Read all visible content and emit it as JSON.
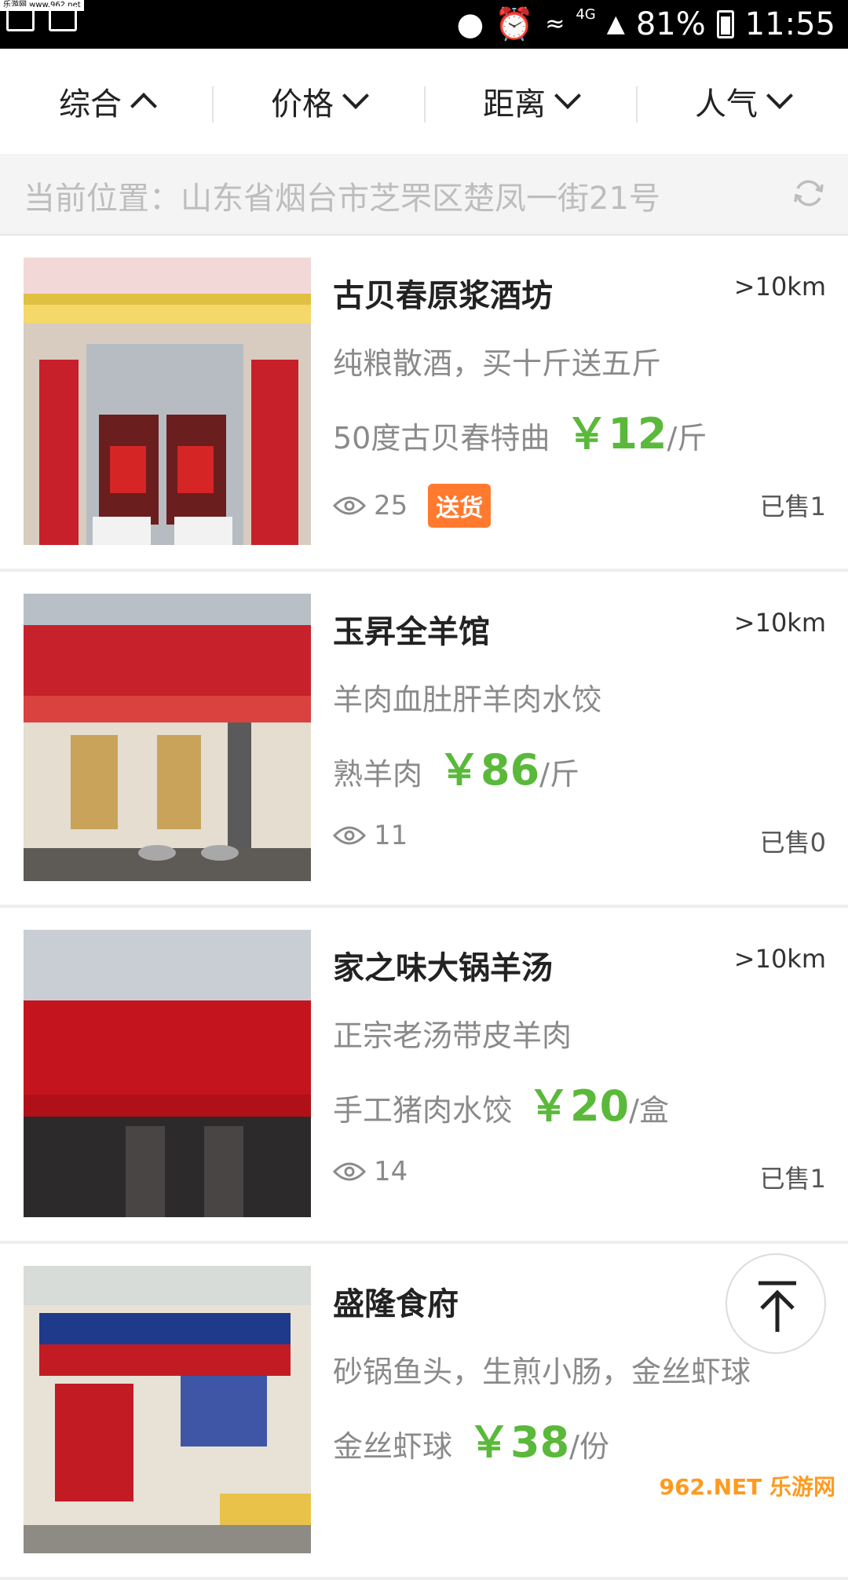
{
  "status_bar": {
    "watermark": "乐游网 www.962.net",
    "network": "4G",
    "battery": "81%",
    "time": "11:55"
  },
  "filters": [
    {
      "label": "综合",
      "icon": "chevron-up-icon"
    },
    {
      "label": "价格",
      "icon": "chevron-down-icon"
    },
    {
      "label": "距离",
      "icon": "chevron-down-icon"
    },
    {
      "label": "人气",
      "icon": "chevron-down-icon"
    }
  ],
  "location": {
    "text": "当前位置：山东省烟台市芝罘区楚凤一街21号",
    "icon": "refresh-icon"
  },
  "items": [
    {
      "title": "古贝春原浆酒坊",
      "distance": ">10km",
      "desc": "纯粮散酒，买十斤送五斤",
      "product": "50度古贝春特曲",
      "price": "￥12",
      "unit": "/斤",
      "views": "25",
      "tag": "送货",
      "sold": "已售1"
    },
    {
      "title": "玉昇全羊馆",
      "distance": ">10km",
      "desc": "羊肉血肚肝羊肉水饺",
      "product": "熟羊肉",
      "price": "￥86",
      "unit": "/斤",
      "views": "11",
      "sold": "已售0"
    },
    {
      "title": "家之味大锅羊汤",
      "distance": ">10km",
      "desc": "正宗老汤带皮羊肉",
      "product": "手工猪肉水饺",
      "price": "￥20",
      "unit": "/盒",
      "views": "14",
      "sold": "已售1"
    },
    {
      "title": "盛隆食府",
      "distance": "",
      "desc": "砂锅鱼头，生煎小肠，金丝虾球",
      "product": "金丝虾球",
      "price": "￥38",
      "unit": "/份",
      "views": "",
      "sold": ""
    }
  ],
  "watermark_bottom": "962.NET 乐游网",
  "colors": {
    "price": "#5ab93a",
    "tag": "#ff7a2f"
  }
}
